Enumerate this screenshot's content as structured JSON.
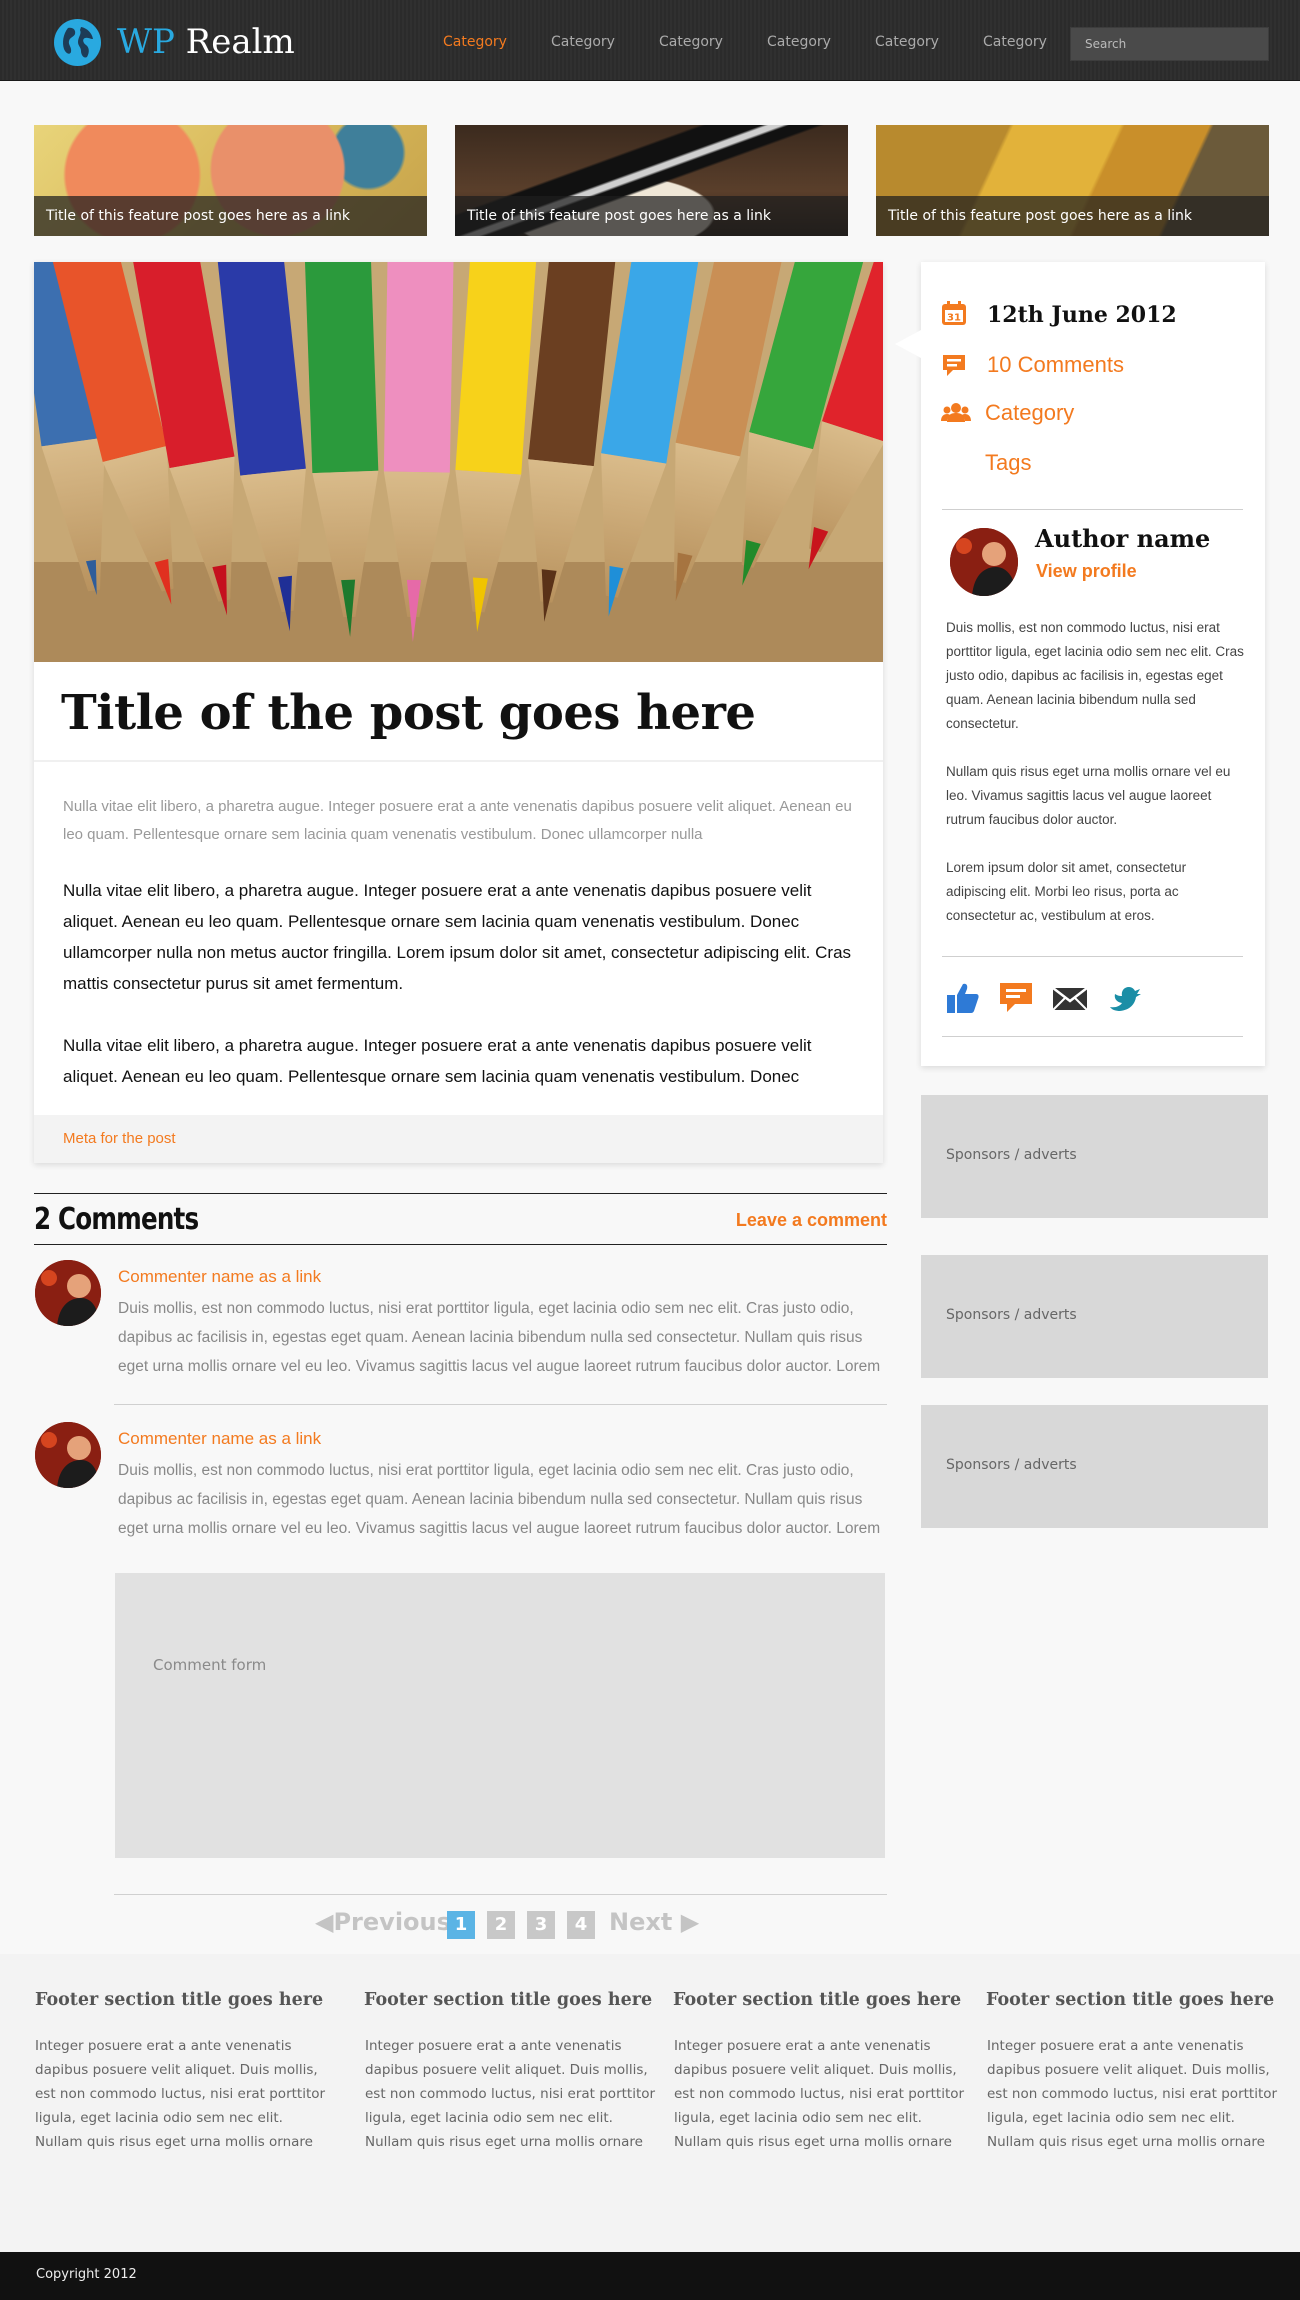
{
  "header": {
    "logo_prefix": "WP",
    "logo_suffix": "Realm",
    "nav": [
      "Category",
      "Category",
      "Category",
      "Category",
      "Category",
      "Category"
    ],
    "active_nav_index": 0,
    "search_placeholder": "Search"
  },
  "features": [
    {
      "caption": "Title of this feature post goes here as a link"
    },
    {
      "caption": "Title of this feature post goes here as a link"
    },
    {
      "caption": "Title of this feature post goes here as a link"
    }
  ],
  "post": {
    "title": "Title of the post goes here",
    "intro": "Nulla vitae elit libero, a pharetra augue. Integer posuere erat a ante venenatis dapibus posuere velit aliquet. Aenean eu leo quam. Pellentesque ornare sem lacinia quam venenatis vestibulum. Donec ullamcorper nulla",
    "paragraphs": [
      "Nulla vitae elit libero, a pharetra augue. Integer posuere erat a ante venenatis dapibus posuere velit aliquet. Aenean eu leo quam. Pellentesque ornare sem lacinia quam venenatis vestibulum. Donec ullamcorper nulla non metus auctor fringilla. Lorem ipsum dolor sit amet, consectetur adipiscing elit. Cras mattis consectetur purus sit amet fermentum.",
      "Nulla vitae elit libero, a pharetra augue. Integer posuere erat a ante venenatis dapibus posuere velit aliquet. Aenean eu leo quam. Pellentesque ornare sem lacinia quam venenatis vestibulum. Donec"
    ],
    "meta": "Meta for the post"
  },
  "comments": {
    "title": "2 Comments",
    "leave_label": "Leave a comment",
    "items": [
      {
        "name": "Commenter name as a link",
        "text": "Duis mollis, est non commodo luctus, nisi erat porttitor ligula, eget lacinia odio sem nec elit. Cras justo odio, dapibus ac facilisis in, egestas eget quam. Aenean lacinia bibendum nulla sed consectetur. Nullam quis risus eget urna mollis ornare vel eu leo. Vivamus sagittis lacus vel augue laoreet rutrum faucibus dolor auctor. Lorem ipsum"
      },
      {
        "name": "Commenter name as a link",
        "text": "Duis mollis, est non commodo luctus, nisi erat porttitor ligula, eget lacinia odio sem nec elit. Cras justo odio, dapibus ac facilisis in, egestas eget quam. Aenean lacinia bibendum nulla sed consectetur. Nullam quis risus eget urna mollis ornare vel eu leo. Vivamus sagittis lacus vel augue laoreet rutrum faucibus dolor auctor. Lorem ipsum"
      }
    ],
    "form_placeholder": "Comment form"
  },
  "pagination": {
    "previous": "Previous",
    "next": "Next",
    "pages": [
      "1",
      "2",
      "3",
      "4"
    ],
    "current_page": 1
  },
  "sidebar": {
    "calendar_day": "31",
    "date": "12th June 2012",
    "comments_link": "10 Comments",
    "category_link": "Category",
    "tags_link": "Tags",
    "author_name": "Author name",
    "view_profile": "View profile",
    "bio": [
      "Duis mollis, est non commodo luctus, nisi erat porttitor ligula, eget lacinia odio sem nec elit. Cras justo odio, dapibus ac facilisis in, egestas eget quam. Aenean lacinia bibendum nulla sed consectetur.",
      "Nullam quis risus eget urna mollis ornare vel eu leo. Vivamus sagittis lacus vel augue laoreet rutrum faucibus dolor auctor.",
      "Lorem ipsum dolor sit amet, consectetur adipiscing elit. Morbi leo risus, porta ac consectetur ac, vestibulum at eros."
    ],
    "share_icons": [
      "thumbs-up-icon",
      "comment-bubble-icon",
      "envelope-icon",
      "twitter-bird-icon"
    ],
    "ads": [
      "Sponsors / adverts",
      "Sponsors / adverts",
      "Sponsors / adverts"
    ]
  },
  "footer": {
    "sections": [
      {
        "title": "Footer section title goes here",
        "text": "Integer posuere erat a ante venenatis dapibus posuere velit aliquet. Duis mollis, est non commodo luctus, nisi erat porttitor ligula, eget lacinia odio sem nec elit. Nullam quis risus eget urna mollis ornare vel eu leo. Donec ullamcorper nulla non metus auctor fringilla. Nullam id dolor id nibh ultricies vehicula ut id"
      },
      {
        "title": "Footer section title goes here",
        "text": "Integer posuere erat a ante venenatis dapibus posuere velit aliquet. Duis mollis, est non commodo luctus, nisi erat porttitor ligula, eget lacinia odio sem nec elit. Nullam quis risus eget urna mollis ornare vel eu leo. Donec ullamcorper nulla non metus auctor fringilla. Nullam id dolor id nibh ultricies"
      },
      {
        "title": "Footer section title goes here",
        "text": "Integer posuere erat a ante venenatis dapibus posuere velit aliquet. Duis mollis, est non commodo luctus, nisi erat porttitor ligula, eget lacinia odio sem nec elit. Nullam quis risus eget urna mollis ornare vel eu leo. Donec ullamcorper nulla non metus auctor fringilla. Nullam id dolor id nibh ultricies"
      },
      {
        "title": "Footer section title goes here",
        "text": "Integer posuere erat a ante venenatis dapibus posuere velit aliquet. Duis mollis, est non commodo luctus, nisi erat porttitor ligula, eget lacinia odio sem nec elit. Nullam quis risus eget urna mollis ornare vel eu leo. Donec ullamcorper nulla non metus auctor fringilla. Nullam id dolor id nibh ultricies"
      }
    ],
    "copyright": "Copyright 2012"
  },
  "colors": {
    "accent": "#f37a1f",
    "brand_blue": "#29a9e0",
    "header_bg": "#2d2d2d",
    "pagination_active": "#5bb4e5"
  }
}
